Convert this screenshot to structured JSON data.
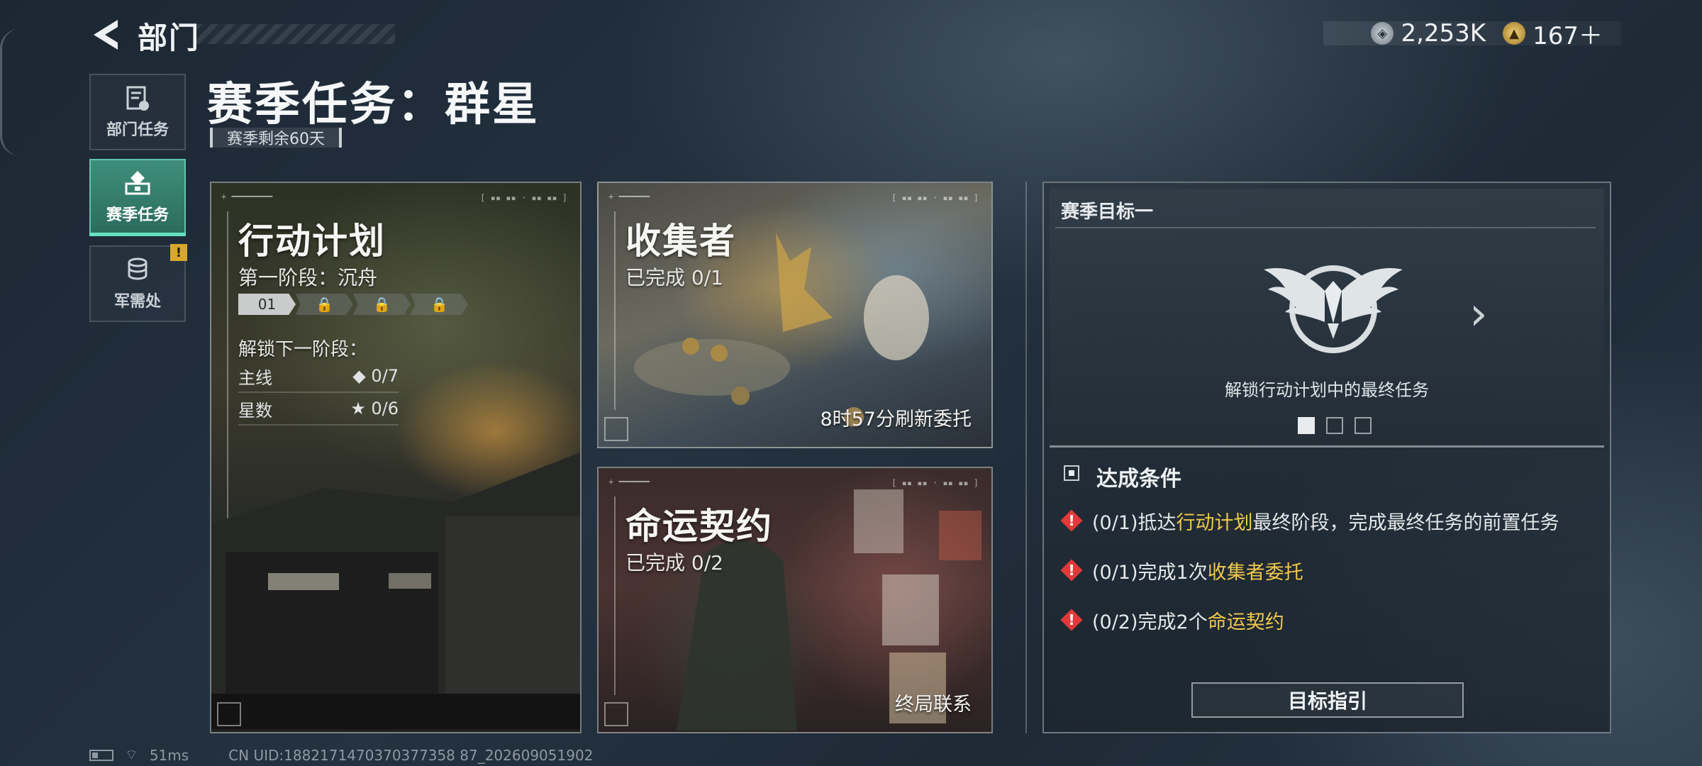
{
  "header": {
    "back_icon": "back-arrow-icon",
    "title": "部门",
    "currencies": [
      {
        "icon": "silver-coin-icon",
        "value": "2,253K"
      },
      {
        "icon": "gold-coin-icon",
        "value": "167＋"
      }
    ]
  },
  "sidebar": {
    "items": [
      {
        "label": "部门任务",
        "icon": "document-icon",
        "active": false
      },
      {
        "label": "赛季任务",
        "icon": "season-badge-icon",
        "active": true
      },
      {
        "label": "军需处",
        "icon": "coin-stack-icon",
        "active": false,
        "badge": "!"
      }
    ]
  },
  "page": {
    "title": "赛季任务：群星",
    "remaining": "赛季剩余60天"
  },
  "cards": {
    "operation": {
      "title": "行动计划",
      "stage": "第一阶段：沉舟",
      "stages": [
        "01",
        "",
        "",
        ""
      ],
      "unlock_label": "解锁下一阶段：",
      "requirements": [
        {
          "label": "主线",
          "value": "◆ 0/7"
        },
        {
          "label": "星数",
          "value": "★ 0/6"
        }
      ]
    },
    "collector": {
      "title": "收集者",
      "progress": "已完成 0/1",
      "footer": "8时57分刷新委托"
    },
    "fate": {
      "title": "命运契约",
      "progress": "已完成 0/2",
      "footer": "终局联系"
    }
  },
  "goal": {
    "header": "赛季目标一",
    "emblem_icon": "eagle-emblem-icon",
    "description": "解锁行动计划中的最终任务",
    "page_count": 3,
    "current_page": 1,
    "conditions_title": "达成条件",
    "conditions": [
      {
        "prefix": "(0/1)抵达",
        "highlight": "行动计划",
        "suffix": "最终阶段，完成最终任务的前置任务"
      },
      {
        "prefix": "(0/1)完成1次",
        "highlight": "收集者委托",
        "suffix": ""
      },
      {
        "prefix": "(0/2)完成2个",
        "highlight": "命运契约",
        "suffix": ""
      }
    ],
    "button": "目标指引"
  },
  "status": {
    "ping": "51ms",
    "uid": "CN UID:1882171470370377358 87_202609051902"
  },
  "colors": {
    "accent_green": "#64e0c3",
    "highlight_yellow": "#f1c84b",
    "warn_red": "#e23a3a"
  }
}
